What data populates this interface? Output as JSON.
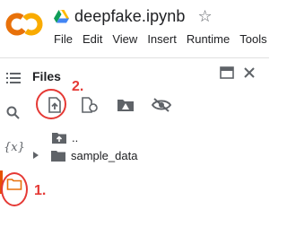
{
  "header": {
    "logo": "CO",
    "drive_icon": "google-drive-icon",
    "notebook_title": "deepfake.ipynb",
    "star_icon": "star-outline-icon",
    "menu": [
      "File",
      "Edit",
      "View",
      "Insert",
      "Runtime",
      "Tools"
    ]
  },
  "rail": {
    "items": [
      "toc-icon",
      "search-icon",
      "variables-icon",
      "folder-icon"
    ],
    "variables_glyph": "{x}"
  },
  "files_panel": {
    "title": "Files",
    "window_icon": "open-in-window-icon",
    "close_icon": "close-icon",
    "toolbar": [
      "upload-icon",
      "refresh-icon",
      "mount-drive-icon",
      "hide-icon"
    ],
    "tree": [
      {
        "name": "..",
        "icon": "folder-up-icon"
      },
      {
        "name": "sample_data",
        "icon": "folder-icon",
        "expandable": true
      }
    ]
  },
  "annotations": {
    "step_1": "1.",
    "step_2": "2."
  },
  "colors": {
    "logo_orange": "#F9AB00",
    "logo_orange_dark": "#E8710A",
    "annotation_red": "#E53935",
    "active_bar": "#E65100"
  }
}
